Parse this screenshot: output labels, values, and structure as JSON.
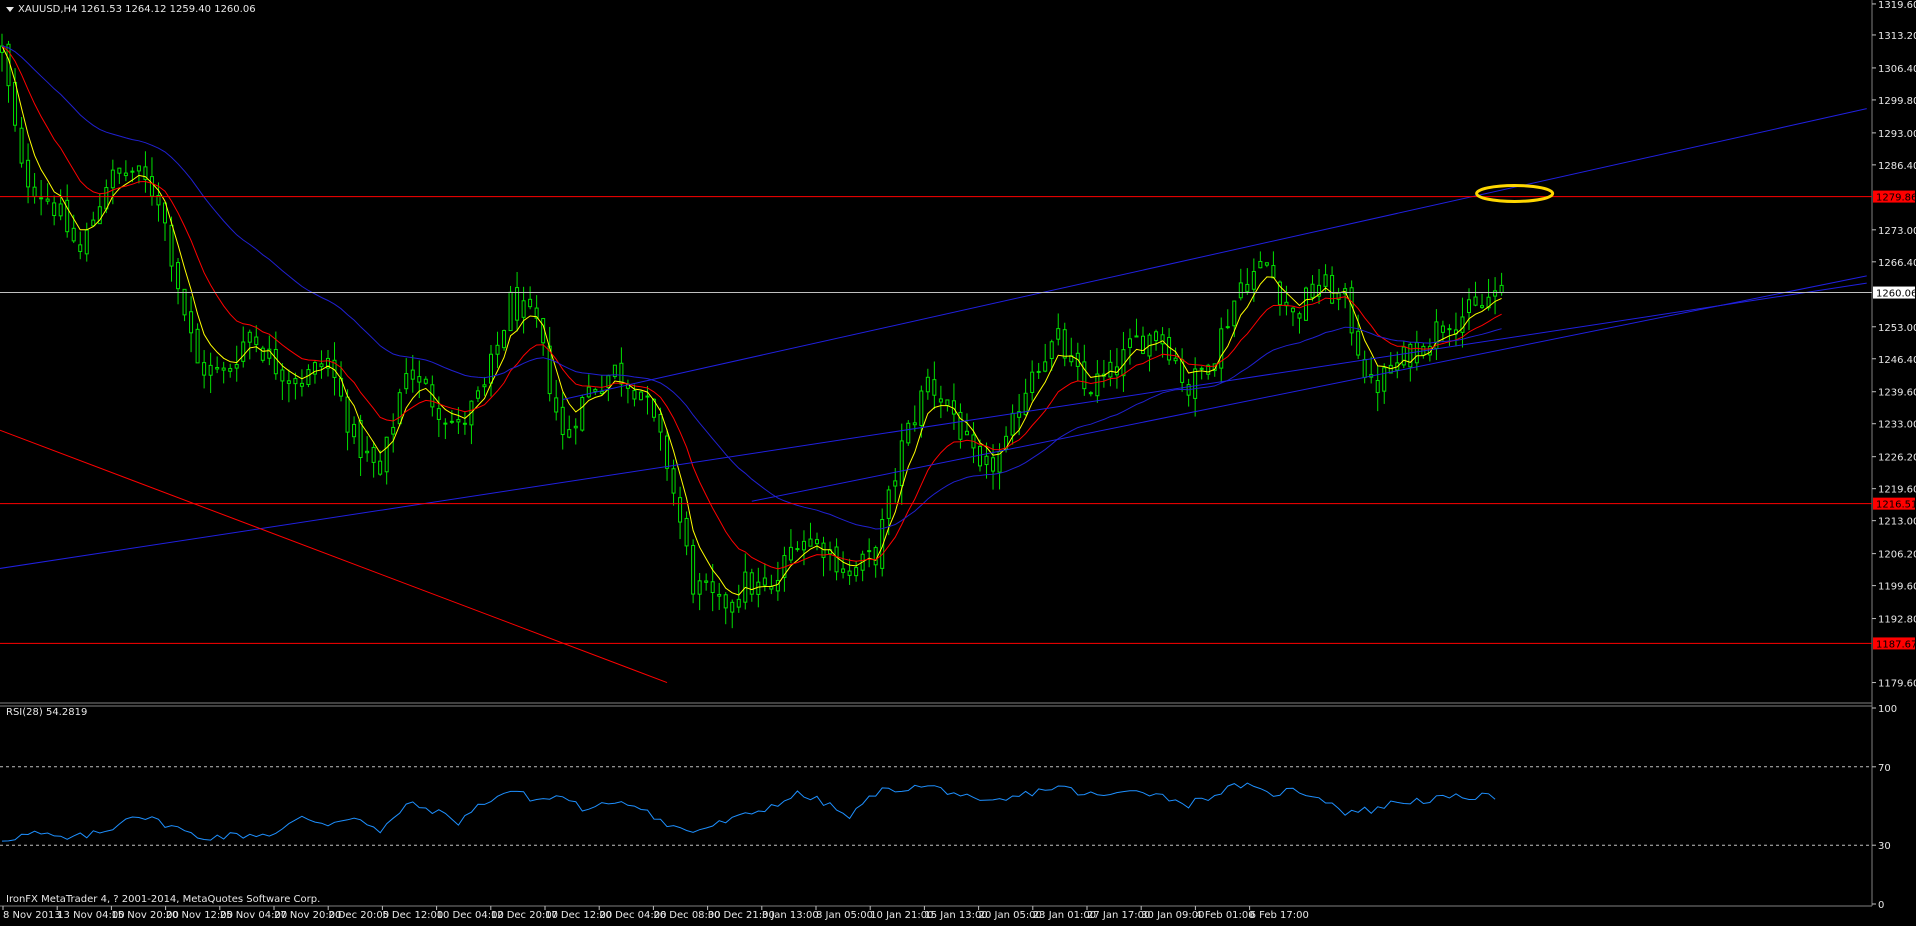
{
  "header": {
    "symbol_line": "XAUUSD,H4  1261.53 1264.12 1259.40 1260.06"
  },
  "rsi": {
    "label": "RSI(28) 54.2819",
    "ticks": [
      "100",
      "70",
      "30",
      "0"
    ]
  },
  "copyright": "IronFX MetaTrader 4, ? 2001-2014, MetaQuotes Software Corp.",
  "colors": {
    "background": "#000000",
    "candles": "#00e000",
    "fast_ma": "#ffff00",
    "mid_ma": "#ff0000",
    "slow_ma": "#2020d0",
    "channel": "#2020e0",
    "horizontal_levels": "#ff0000",
    "current_price_line": "#c0c0c0",
    "rsi_line": "#1e90ff",
    "annotation_ellipse": "#ffd700"
  },
  "chart_data": {
    "type": "candlestick",
    "ohlc": [
      1261.53,
      1264.12,
      1259.4,
      1260.06
    ],
    "price_axis": {
      "ticks": [
        "1319.60",
        "1313.20",
        "1306.40",
        "1299.80",
        "1293.00",
        "1286.40",
        "1273.00",
        "1266.40",
        "1253.00",
        "1246.40",
        "1239.60",
        "1233.00",
        "1226.20",
        "1219.60",
        "1213.00",
        "1206.20",
        "1199.60",
        "1192.80",
        "1179.60"
      ],
      "ylim": [
        1176,
        1320
      ]
    },
    "time_axis": {
      "labels": [
        "8 Nov 2013",
        "13 Nov 04:00",
        "15 Nov 20:00",
        "20 Nov 12:00",
        "25 Nov 04:00",
        "27 Nov 20:00",
        "2 Dec 20:00",
        "5 Dec 12:00",
        "10 Dec 04:00",
        "12 Dec 20:00",
        "17 Dec 12:00",
        "20 Dec 04:00",
        "26 Dec 08:00",
        "30 Dec 21:00",
        "3 Jan 13:00",
        "8 Jan 05:00",
        "10 Jan 21:00",
        "15 Jan 13:00",
        "20 Jan 05:00",
        "23 Jan 01:00",
        "27 Jan 17:00",
        "30 Jan 09:00",
        "4 Feb 01:00",
        "6 Feb 17:00"
      ]
    },
    "current_price": {
      "label": "1260.06",
      "value": 1260.06
    },
    "levels": [
      {
        "label": "1279.86",
        "value": 1279.86
      },
      {
        "label": "1216.51",
        "value": 1216.51
      },
      {
        "label": "1187.67",
        "value": 1187.67
      }
    ],
    "price_path": [
      [
        0,
        1310
      ],
      [
        3,
        1285
      ],
      [
        8,
        1278
      ],
      [
        12,
        1268
      ],
      [
        16,
        1283
      ],
      [
        20,
        1285
      ],
      [
        24,
        1280
      ],
      [
        28,
        1256
      ],
      [
        30,
        1245
      ],
      [
        34,
        1243
      ],
      [
        38,
        1252
      ],
      [
        42,
        1245
      ],
      [
        46,
        1242
      ],
      [
        50,
        1246
      ],
      [
        54,
        1230
      ],
      [
        58,
        1222
      ],
      [
        62,
        1245
      ],
      [
        66,
        1238
      ],
      [
        70,
        1232
      ],
      [
        74,
        1240
      ],
      [
        78,
        1258
      ],
      [
        82,
        1253
      ],
      [
        86,
        1230
      ],
      [
        90,
        1240
      ],
      [
        94,
        1244
      ],
      [
        98,
        1240
      ],
      [
        102,
        1225
      ],
      [
        106,
        1200
      ],
      [
        110,
        1195
      ],
      [
        114,
        1200
      ],
      [
        118,
        1198
      ],
      [
        122,
        1210
      ],
      [
        126,
        1208
      ],
      [
        130,
        1202
      ],
      [
        134,
        1206
      ],
      [
        138,
        1228
      ],
      [
        142,
        1242
      ],
      [
        146,
        1235
      ],
      [
        150,
        1222
      ],
      [
        154,
        1228
      ],
      [
        158,
        1245
      ],
      [
        162,
        1250
      ],
      [
        166,
        1240
      ],
      [
        170,
        1243
      ],
      [
        174,
        1250
      ],
      [
        178,
        1252
      ],
      [
        182,
        1240
      ],
      [
        186,
        1248
      ],
      [
        190,
        1262
      ],
      [
        194,
        1266
      ],
      [
        198,
        1255
      ],
      [
        202,
        1262
      ],
      [
        206,
        1258
      ],
      [
        210,
        1240
      ],
      [
        214,
        1245
      ],
      [
        218,
        1250
      ],
      [
        222,
        1255
      ],
      [
        226,
        1256
      ],
      [
        229,
        1260
      ]
    ],
    "rsi_series": [
      [
        0,
        33
      ],
      [
        5,
        36
      ],
      [
        10,
        33
      ],
      [
        16,
        37
      ],
      [
        20,
        46
      ],
      [
        26,
        40
      ],
      [
        30,
        34
      ],
      [
        36,
        35
      ],
      [
        42,
        36
      ],
      [
        46,
        44
      ],
      [
        50,
        41
      ],
      [
        54,
        45
      ],
      [
        58,
        36
      ],
      [
        62,
        51
      ],
      [
        66,
        48
      ],
      [
        70,
        42
      ],
      [
        74,
        52
      ],
      [
        78,
        58
      ],
      [
        82,
        53
      ],
      [
        86,
        55
      ],
      [
        90,
        47
      ],
      [
        94,
        53
      ],
      [
        98,
        50
      ],
      [
        102,
        40
      ],
      [
        106,
        37
      ],
      [
        110,
        41
      ],
      [
        114,
        45
      ],
      [
        118,
        50
      ],
      [
        122,
        56
      ],
      [
        126,
        52
      ],
      [
        130,
        44
      ],
      [
        134,
        57
      ],
      [
        138,
        59
      ],
      [
        142,
        60
      ],
      [
        146,
        57
      ],
      [
        150,
        51
      ],
      [
        154,
        53
      ],
      [
        158,
        57
      ],
      [
        162,
        60
      ],
      [
        166,
        56
      ],
      [
        170,
        55
      ],
      [
        174,
        59
      ],
      [
        178,
        55
      ],
      [
        182,
        51
      ],
      [
        186,
        56
      ],
      [
        190,
        61
      ],
      [
        194,
        56
      ],
      [
        198,
        58
      ],
      [
        202,
        55
      ],
      [
        206,
        47
      ],
      [
        210,
        48
      ],
      [
        214,
        52
      ],
      [
        218,
        53
      ],
      [
        222,
        54
      ],
      [
        226,
        55
      ],
      [
        229,
        54
      ]
    ],
    "rsi_levels": [
      70,
      30
    ],
    "rsi_ylim": [
      0,
      100
    ]
  }
}
